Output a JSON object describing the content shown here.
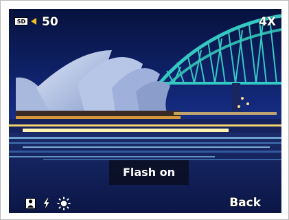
{
  "status_bar": {
    "storage_icon": "sd-card-icon",
    "indicator_icon": "left-arrow-indicator-icon",
    "shots_remaining": "50",
    "zoom_level": "4X"
  },
  "toast": {
    "message": "Flash on"
  },
  "bottom_bar": {
    "icons": [
      "scene-mode-icon",
      "flash-icon",
      "white-balance-sun-icon"
    ],
    "back_label": "Back"
  },
  "colors": {
    "sky": "#0b1a4a",
    "bridge": "#35c9c4",
    "indicator": "#f0c020",
    "text": "#ffffff"
  }
}
